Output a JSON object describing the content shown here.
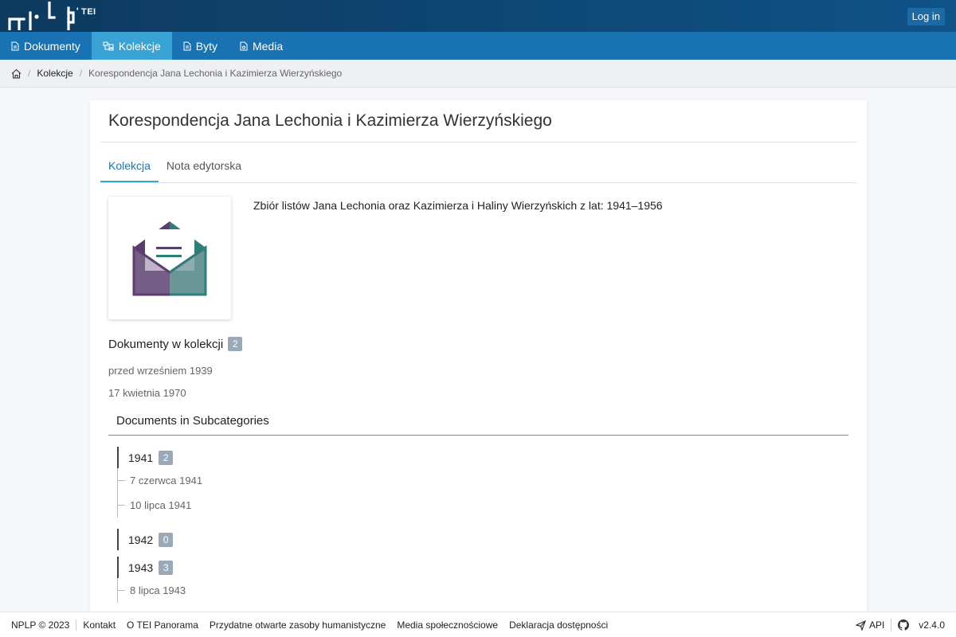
{
  "header": {
    "logo_text": "TEI",
    "login_label": "Log in"
  },
  "nav": {
    "items": [
      {
        "label": "Dokumenty",
        "icon": "document-icon"
      },
      {
        "label": "Kolekcje",
        "icon": "collection-icon",
        "active": true
      },
      {
        "label": "Byty",
        "icon": "entity-icon"
      },
      {
        "label": "Media",
        "icon": "media-icon"
      }
    ]
  },
  "breadcrumb": {
    "home_icon": "home-icon",
    "items": [
      "Kolekcje",
      "Korespondencja Jana Lechonia i Kazimierza Wierzyńskiego"
    ]
  },
  "page": {
    "title": "Korespondencja Jana Lechonia i Kazimierza Wierzyńskiego",
    "tabs": [
      "Kolekcja",
      "Nota edytorska"
    ],
    "active_tab": "Kolekcja",
    "description": "Zbiór listów Jana Lechonia oraz Kazimierza i Haliny Wierzyńskich z lat: 1941–1956",
    "thumbnail_icon": "envelope-letter-icon"
  },
  "documents": {
    "heading": "Dokumenty w kolekcji",
    "count": "2",
    "items": [
      "przed wrześniem 1939",
      "17 kwietnia 1970"
    ]
  },
  "subcategories": {
    "heading": "Documents in Subcategories",
    "years": [
      {
        "year": "1941",
        "count": "2",
        "items": [
          "7 czerwca 1941",
          "10 lipca 1941"
        ]
      },
      {
        "year": "1942",
        "count": "0",
        "items": []
      },
      {
        "year": "1943",
        "count": "3",
        "items": [
          "8 lipca 1943"
        ]
      }
    ]
  },
  "footer": {
    "copyright": "NPLP © 2023",
    "links": [
      "Kontakt",
      "O TEI Panorama",
      "Przydatne otwarte zasoby humanistyczne",
      "Media społecznościowe",
      "Deklaracja dostępności"
    ],
    "api_label": "API",
    "version": "v2.4.0"
  },
  "colors": {
    "topbar": "#0d3a5f",
    "navbar": "#1973b2",
    "nav_active": "#3aa3d5",
    "envelope_purple": "#5b3e6e",
    "envelope_teal": "#2f7f78"
  }
}
